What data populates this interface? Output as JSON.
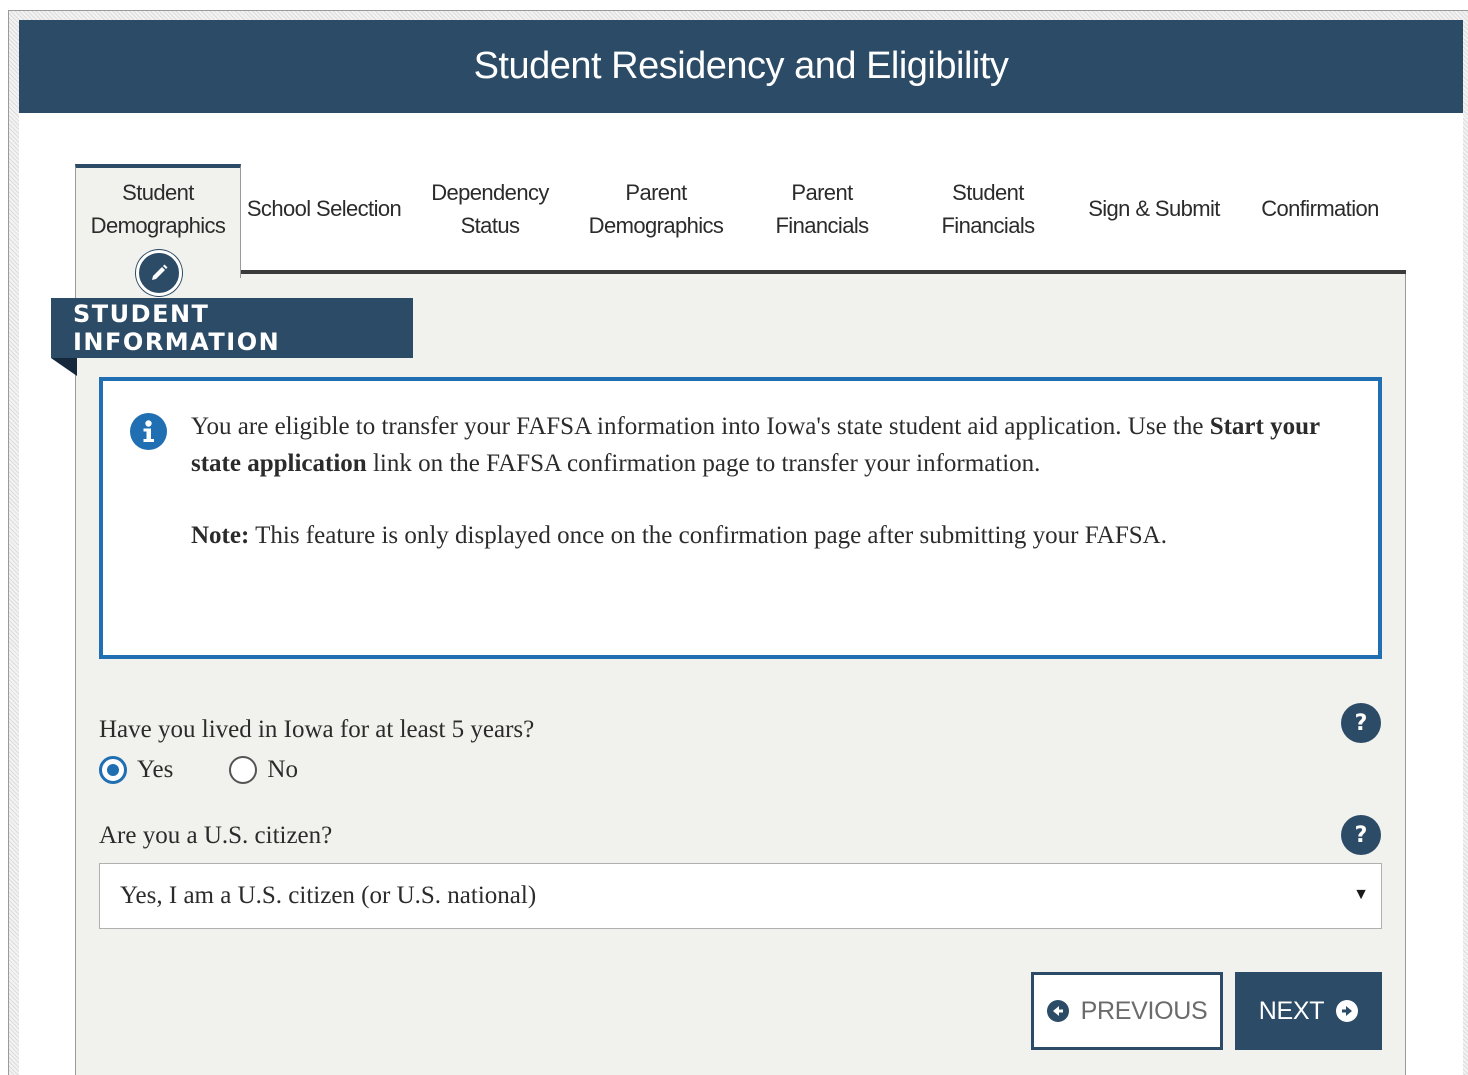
{
  "header": {
    "title": "Student Residency and Eligibility"
  },
  "tabs": [
    {
      "line1": "Student",
      "line2": "Demographics",
      "active": true
    },
    {
      "line1": "School Selection",
      "line2": ""
    },
    {
      "line1": "Dependency",
      "line2": "Status"
    },
    {
      "line1": "Parent",
      "line2": "Demographics"
    },
    {
      "line1": "Parent",
      "line2": "Financials"
    },
    {
      "line1": "Student",
      "line2": "Financials"
    },
    {
      "line1": "Sign & Submit",
      "line2": ""
    },
    {
      "line1": "Confirmation",
      "line2": ""
    }
  ],
  "section": {
    "title": "STUDENT INFORMATION"
  },
  "info": {
    "line1": "You are eligible to transfer your FAFSA information into Iowa's state student aid application.",
    "line2_pre": "Use the ",
    "line2_bold": "Start your state application",
    "line2_post": " link on the FAFSA confirmation page to transfer your information.",
    "note_label": "Note:",
    "note_text": " This feature is only displayed once on the confirmation page after submitting your FAFSA."
  },
  "q1": {
    "label": "Have you lived in Iowa for at least 5 years?",
    "options": [
      "Yes",
      "No"
    ],
    "selected": "Yes",
    "help": "?"
  },
  "q2": {
    "label": "Are you a U.S. citizen?",
    "value": "Yes, I am a U.S. citizen (or U.S. national)",
    "help": "?"
  },
  "buttons": {
    "previous": "PREVIOUS",
    "next": "NEXT"
  },
  "colors": {
    "brand": "#2c4b66",
    "accent": "#1f6fb2",
    "panel": "#f1f1ed"
  }
}
